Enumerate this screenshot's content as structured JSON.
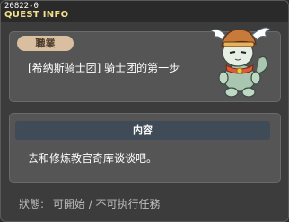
{
  "window": {
    "quest_id": "20822-0",
    "title": "QUEST INFO"
  },
  "quest": {
    "job_badge": "職業",
    "name": "[希纳斯骑士团] 骑士团的第一步"
  },
  "content": {
    "header": "内容",
    "text": "去和修炼教官奇库谈谈吧。"
  },
  "status": {
    "label": "狀態:",
    "value": "可開始 / 不可执行任務"
  },
  "colors": {
    "title_yellow": "#f4e08a",
    "badge_bg": "#d9bfa0",
    "header_bar": "#3f4c57"
  },
  "icons": {
    "mascot": "winged-helmet-cat-mascot-icon"
  }
}
